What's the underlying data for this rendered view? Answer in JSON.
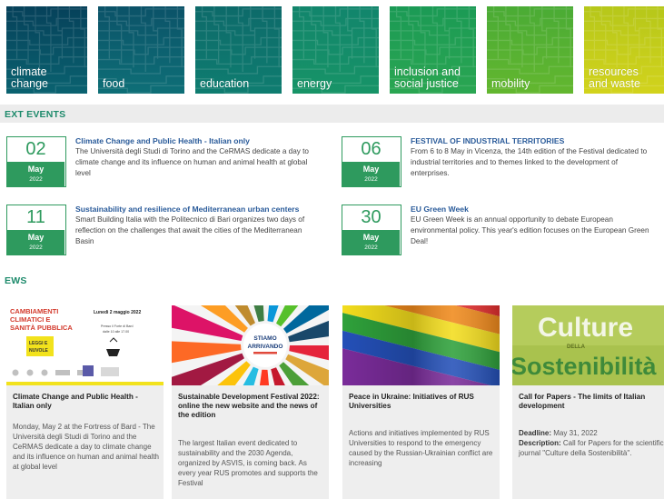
{
  "topics": [
    {
      "label": "climate\nchange",
      "color_top": "#06415a",
      "color_bottom": "#0a6270"
    },
    {
      "label": "food",
      "color_top": "#0b5268",
      "color_bottom": "#0e6f77"
    },
    {
      "label": "education",
      "color_top": "#0d6a6a",
      "color_bottom": "#0f7d70"
    },
    {
      "label": "energy",
      "color_top": "#12856c",
      "color_bottom": "#179467"
    },
    {
      "label": "inclusion and\nsocial justice",
      "color_top": "#1b9a55",
      "color_bottom": "#2aa652"
    },
    {
      "label": "mobility",
      "color_top": "#4aab35",
      "color_bottom": "#63b72f"
    },
    {
      "label": "resources\nand waste",
      "color_top": "#b6c71a",
      "color_bottom": "#d2d31c"
    }
  ],
  "events_section": {
    "title": "EXT EVENTS"
  },
  "events": [
    {
      "day": "02",
      "month": "May",
      "year": "2022",
      "title": "Climate Change and Public Health - Italian only",
      "description": "The Università degli Studi di Torino and the CeRMAS dedicate a day to climate change and its influence on human and animal health at global level"
    },
    {
      "day": "06",
      "month": "May",
      "year": "2022",
      "title": "FESTIVAL OF INDUSTRIAL TERRITORIES",
      "description": "From 6 to 8 May in Vicenza, the 14th edition of the Festival dedicated to industrial territories and to themes linked to the development of enterprises."
    },
    {
      "day": "11",
      "month": "May",
      "year": "2022",
      "title": "Sustainability and resilience of Mediterranean urban centers",
      "description": "Smart Building Italia with the Politecnico di Bari organizes two days of reflection on the challenges that await the cities of the Mediterranean Basin"
    },
    {
      "day": "30",
      "month": "May",
      "year": "2022",
      "title": "EU Green Week",
      "description": "EU Green Week is an annual opportunity to debate European environmental policy. This year's edition focuses on the European Green Deal!"
    }
  ],
  "news_section": {
    "title": "EWS"
  },
  "news": [
    {
      "title": "Climate Change and Public Health - Italian only",
      "body": "Monday, May 2 at the Fortress of Bard - The Università degli Studi di Torino and the CeRMAS dedicate a day to climate change and its influence on human and animal health at global level",
      "image": {
        "line1": "CAMBIAMENTI",
        "line2": "CLIMATICI E",
        "line3": "SANITÀ PUBBLICA",
        "date": "Lunedì 2 maggio 2022",
        "sub1": "Presso il Forte di Bard",
        "sub2": "dalle 10 alle 17.00",
        "badge1": "LEGGI E",
        "badge2": "NUVOLE"
      }
    },
    {
      "title": "Sustainable Development Festival 2022: online the new website and the news of the edition",
      "body": "The largest Italian event dedicated to sustainability and the 2030 Agenda, organized by ASVIS, is coming back. As every year RUS promotes and supports the Festival",
      "image": {
        "line1": "STIAMO",
        "line2": "ARRIVANDO"
      }
    },
    {
      "title": "Peace in Ukraine: Initiatives of RUS Universities",
      "body": "Actions and initiatives implemented by RUS Universities to respond to the emergency caused by the Russian-Ukrainian conflict are increasing"
    },
    {
      "title": "Call for Papers - The limits of Italian development",
      "deadline_label": "Deadline:",
      "deadline_value": "May 31, 2022",
      "description_label": "Description:",
      "description_value": "Call for Papers for the scientific journal \"Culture della Sostenibilità\".",
      "image": {
        "line1": "Culture",
        "small": "DELLA",
        "line2": "Sostenibilità"
      }
    }
  ]
}
